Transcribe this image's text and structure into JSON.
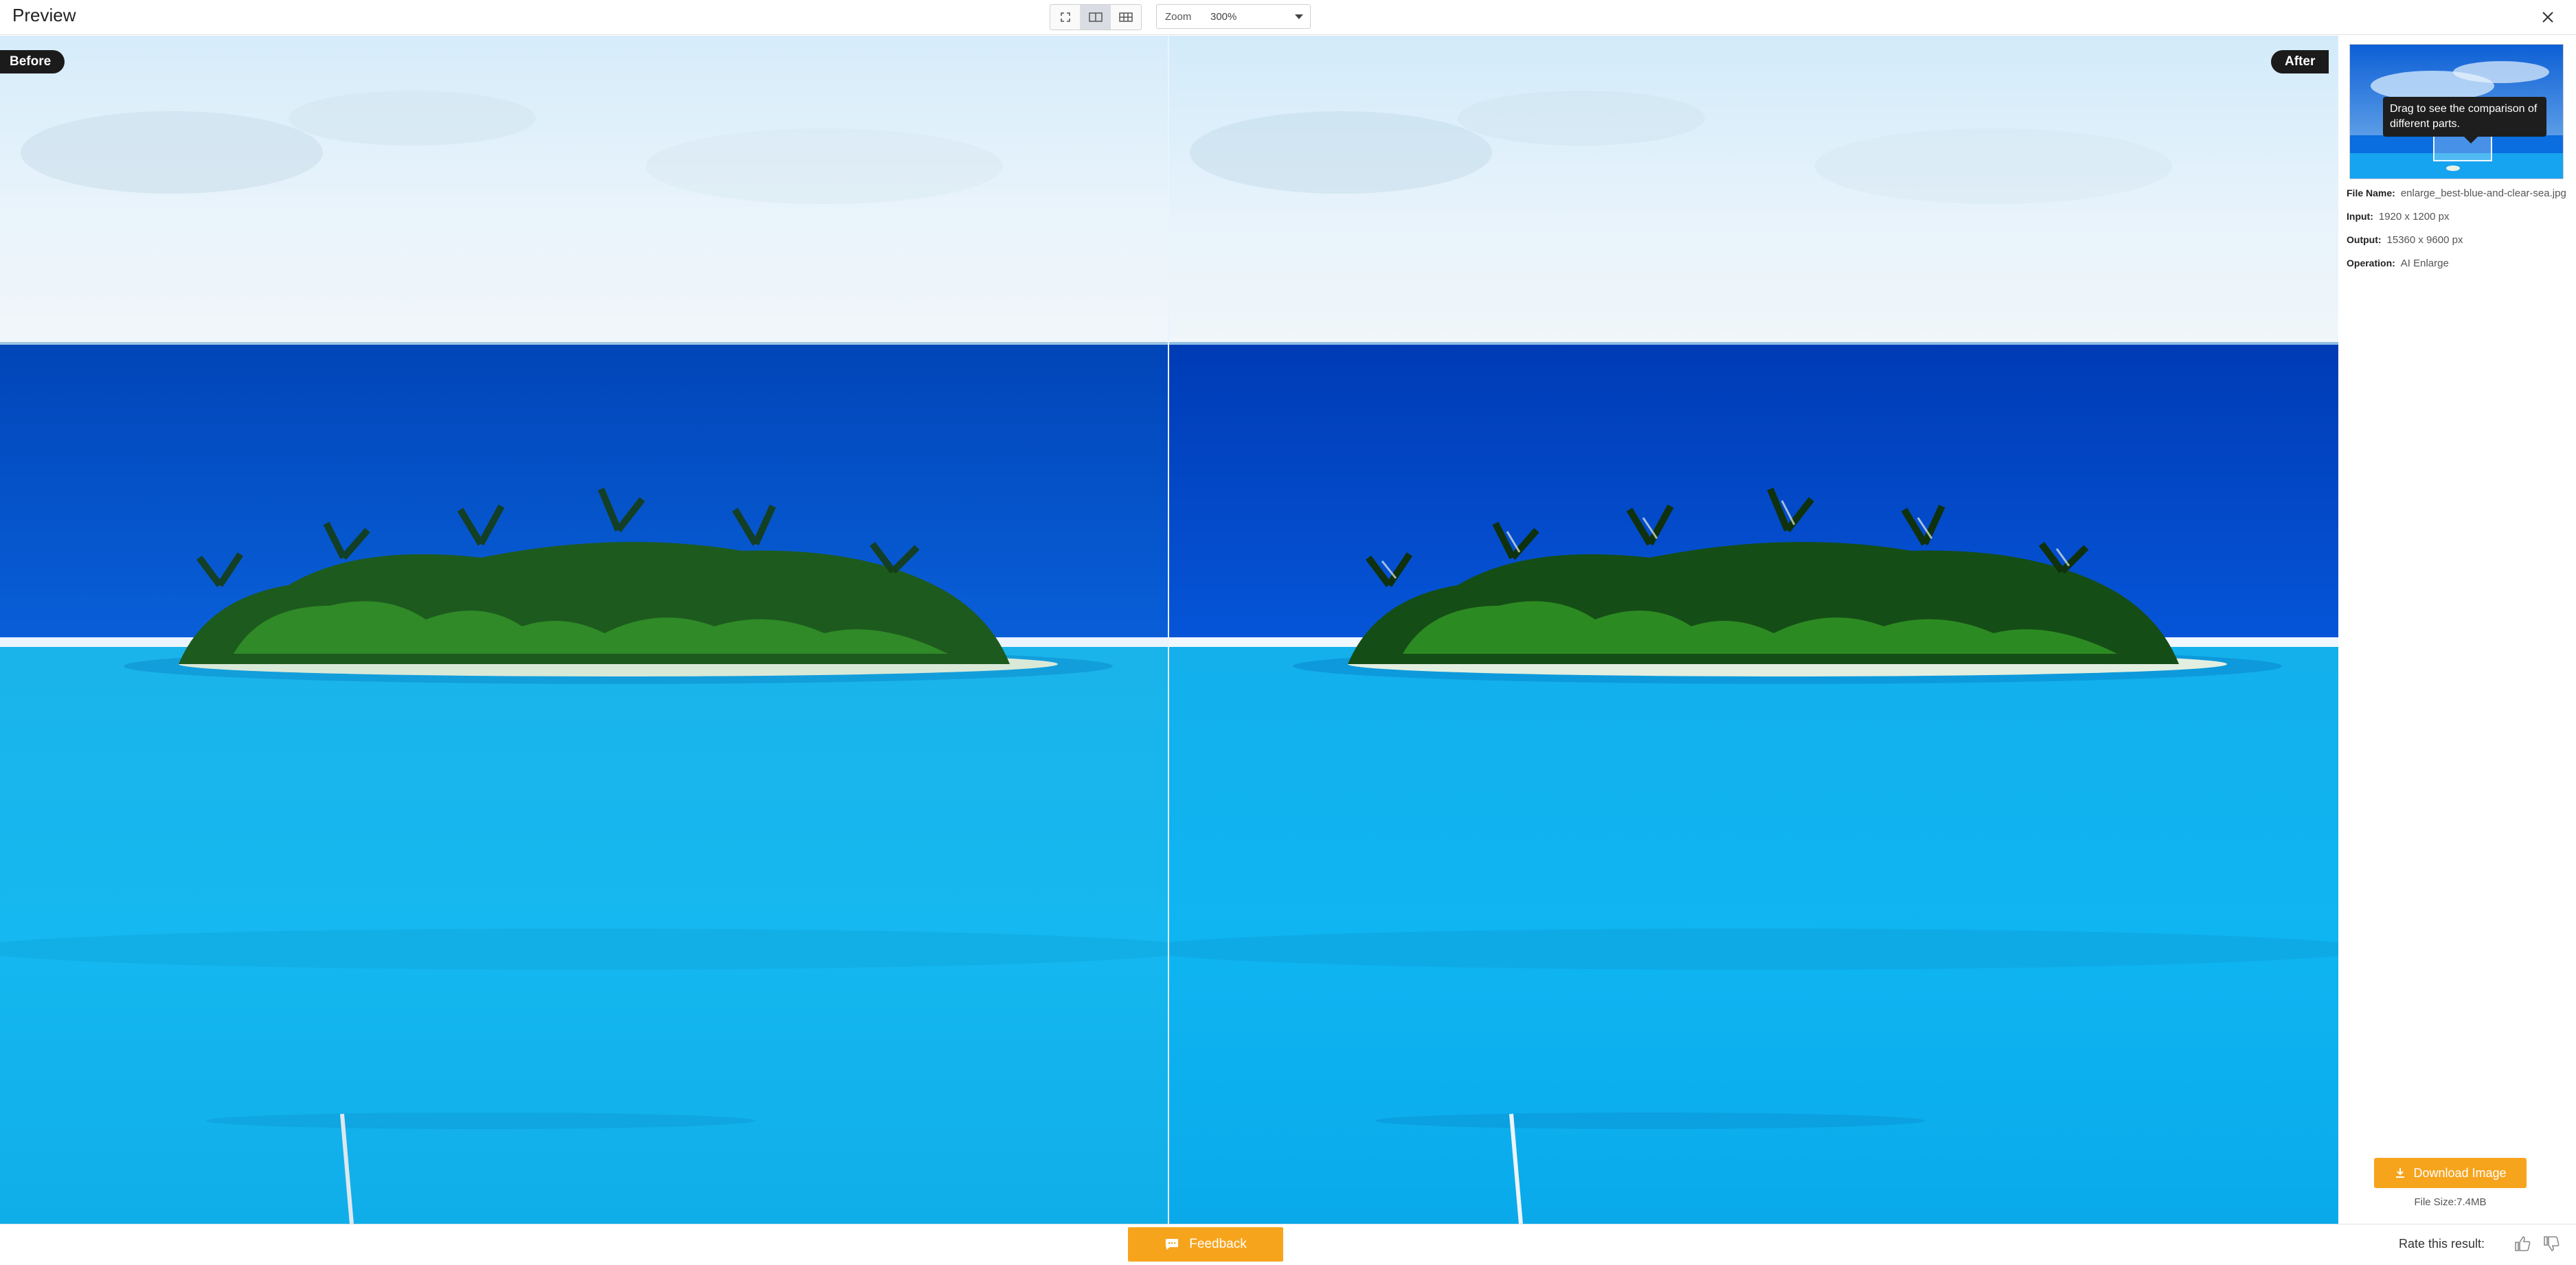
{
  "header": {
    "title": "Preview",
    "view_modes": [
      "fullscreen",
      "side-by-side",
      "grid"
    ],
    "zoom_label": "Zoom",
    "zoom_value": "300%"
  },
  "compare": {
    "before_label": "Before",
    "after_label": "After"
  },
  "side_panel": {
    "tooltip": "Drag to see the comparison of different parts.",
    "info": [
      {
        "key": "File Name:",
        "value": "enlarge_best-blue-and-clear-sea.jpg"
      },
      {
        "key": "Input:",
        "value": "1920 x 1200 px"
      },
      {
        "key": "Output:",
        "value": "15360 x 9600 px"
      },
      {
        "key": "Operation:",
        "value": "AI Enlarge"
      }
    ],
    "download_label": "Download Image",
    "file_size": "File Size:7.4MB"
  },
  "footer": {
    "feedback_label": "Feedback",
    "rate_label": "Rate this result:"
  },
  "colors": {
    "accent": "#f7a41d",
    "sky": "#e4f1fa",
    "deep_sea": "#0043c2",
    "shallow_sea": "#11b7ee",
    "island": "#1d5a1e"
  }
}
